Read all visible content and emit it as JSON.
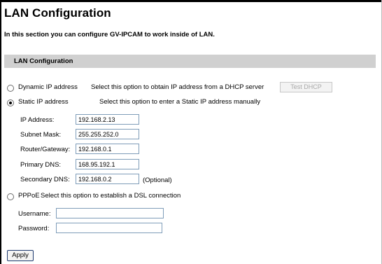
{
  "header": {
    "title": "LAN Configuration",
    "intro": "In this section you can configure GV-IPCAM to work inside of LAN."
  },
  "section": {
    "title": "LAN Configuration"
  },
  "dynamic": {
    "label": "Dynamic IP address",
    "description": "Select this option to obtain IP address from a DHCP server",
    "test_button": "Test DHCP",
    "selected": false
  },
  "static": {
    "label": "Static IP address",
    "description": "Select this option to enter a Static IP address manually",
    "selected": true,
    "fields": {
      "ip_label": "IP Address:",
      "ip_value": "192.168.2.13",
      "mask_label": "Subnet Mask:",
      "mask_value": "255.255.252.0",
      "router_label": "Router/Gateway:",
      "router_value": "192.168.0.1",
      "dns1_label": "Primary DNS:",
      "dns1_value": "168.95.192.1",
      "dns2_label": "Secondary DNS:",
      "dns2_value": "192.168.0.2",
      "optional_note": "(Optional)"
    }
  },
  "pppoe": {
    "label": "PPPoE",
    "description": "Select this option to establish a DSL connection",
    "selected": false,
    "username_label": "Username:",
    "password_label": "Password:",
    "username_value": "",
    "password_value": ""
  },
  "actions": {
    "apply": "Apply"
  }
}
